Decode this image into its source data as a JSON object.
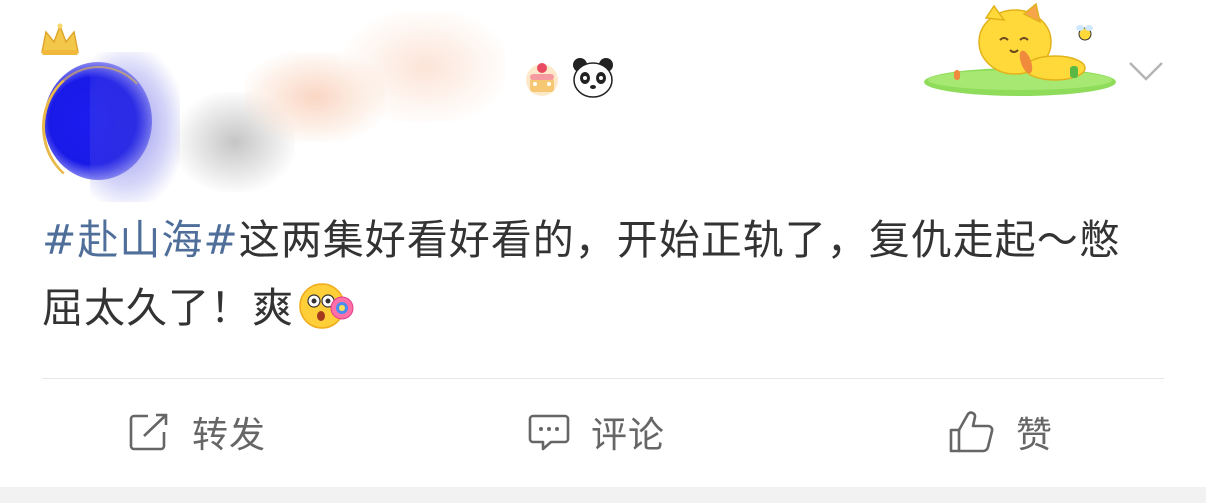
{
  "post": {
    "hashtag": "#赴山海#",
    "text": "这两集好看好看的，开始正轨了，复仇走起～憋屈太久了！爽",
    "emoji_icon": "excited-face-emoji-icon"
  },
  "actions": {
    "forward_label": "转发",
    "comment_label": "评论",
    "like_label": "赞"
  },
  "colors": {
    "hashtag": "#4f6f9a",
    "text": "#333333",
    "action_text": "#666666",
    "avatar": "#1a1ae8"
  }
}
